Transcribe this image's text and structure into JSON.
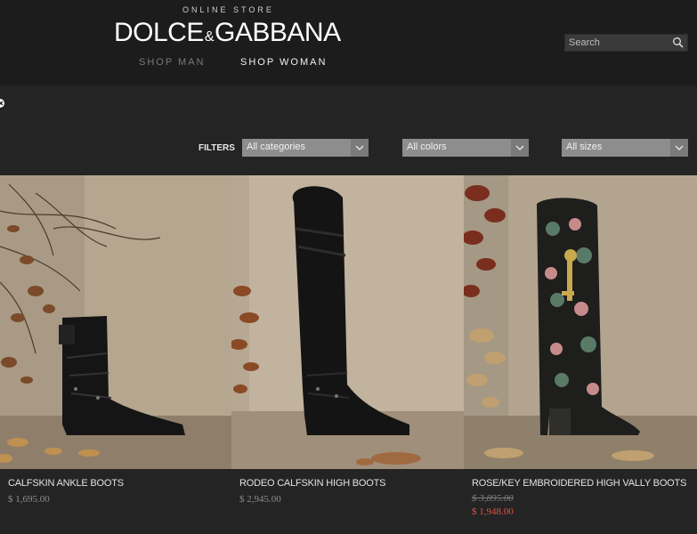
{
  "header": {
    "tagline": "ONLINE STORE",
    "logo_left": "DOLCE",
    "logo_amp": "&",
    "logo_right": "GABBANA",
    "nav": [
      {
        "label": "SHOP MAN"
      },
      {
        "label": "SHOP WOMAN"
      }
    ],
    "search_placeholder": "Search",
    "search_icon": "search-icon"
  },
  "toolbar": {
    "back_icon": "close-circle-icon",
    "filters_label": "FILTERS",
    "selects": [
      {
        "value": "All categories"
      },
      {
        "value": "All colors"
      },
      {
        "value": "All sizes"
      }
    ]
  },
  "products": [
    {
      "name": "CALFSKIN ANKLE BOOTS",
      "price": "$ 1,695.00"
    },
    {
      "name": "RODEO CALFSKIN HIGH BOOTS",
      "price": "$ 2,945.00"
    },
    {
      "name": "ROSE/KEY EMBROIDERED HIGH VALLY BOOTS",
      "old_price": "$ 3,895.00",
      "sale_price": "$ 1,948.00"
    }
  ],
  "colors": {
    "header_bg": "#1c1c1c",
    "page_bg": "#242424",
    "sale": "#e0534a"
  }
}
